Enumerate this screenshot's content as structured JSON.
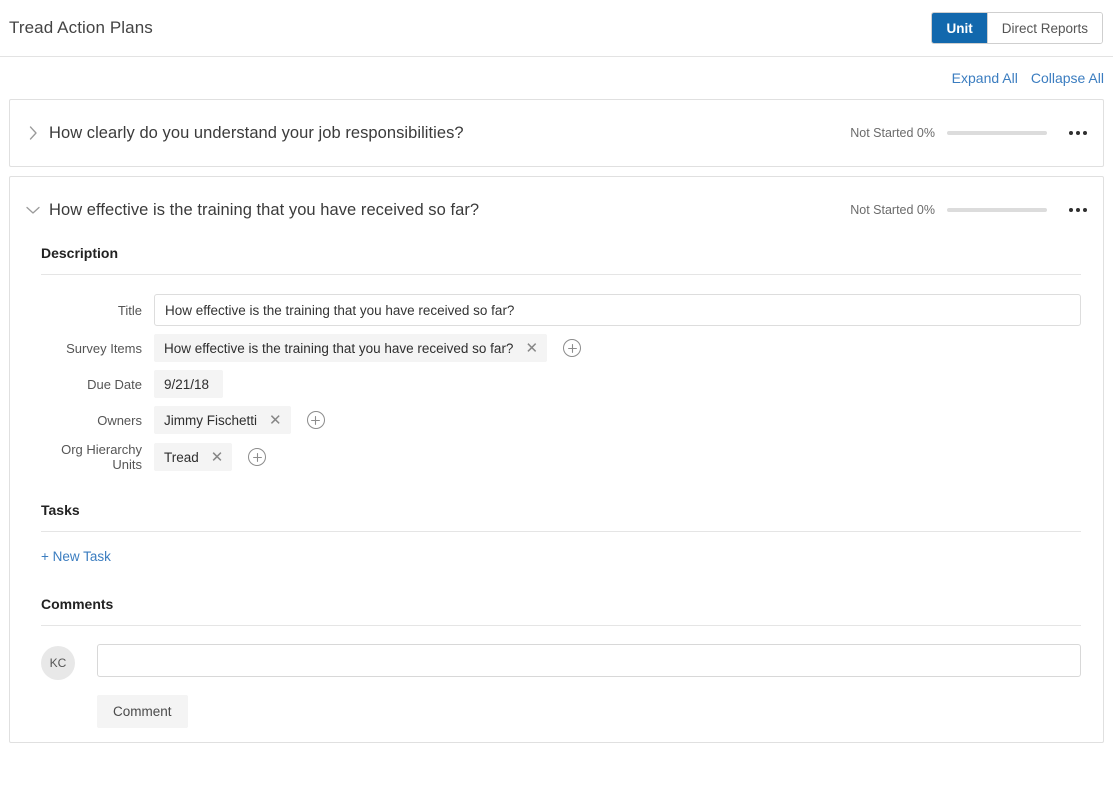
{
  "header": {
    "title": "Tread Action Plans",
    "view_toggle": {
      "options": [
        "Unit",
        "Direct Reports"
      ],
      "selected": "Unit",
      "unit_label": "Unit",
      "direct_reports_label": "Direct Reports",
      "active_color": "#1268ad"
    }
  },
  "toolbar": {
    "expand_all_label": "Expand All",
    "collapse_all_label": "Collapse All",
    "link_color": "#3b7dc0"
  },
  "action_plans": [
    {
      "title": "How clearly do you understand your job responsibilities?",
      "expanded": false,
      "chevron": "chevron-right-icon",
      "status_text": "Not Started 0%",
      "status": "Not Started",
      "progress_percent": 0,
      "menu_icon": "kebab-menu-icon"
    },
    {
      "title": "How effective is the training that you have received so far?",
      "expanded": true,
      "chevron": "chevron-down-icon",
      "status_text": "Not Started 0%",
      "status": "Not Started",
      "progress_percent": 0,
      "menu_icon": "kebab-menu-icon"
    }
  ],
  "detail": {
    "description_section": {
      "heading": "Description",
      "fields": {
        "title": {
          "label": "Title",
          "value": "How effective is the training that you have received so far?",
          "placeholder": ""
        },
        "survey_items": {
          "label": "Survey Items",
          "chips": [
            "How effective is the training that you have received so far?"
          ],
          "remove_icon": "close-icon",
          "add_icon": "plus-circle-icon"
        },
        "due_date": {
          "label": "Due Date",
          "value": "9/21/18"
        },
        "owners": {
          "label": "Owners",
          "chips": [
            "Jimmy Fischetti"
          ],
          "remove_icon": "close-icon",
          "add_icon": "plus-circle-icon"
        },
        "org_hierarchy_units": {
          "label": "Org Hierarchy Units",
          "chips": [
            "Tread"
          ],
          "remove_icon": "close-icon",
          "add_icon": "plus-circle-icon"
        }
      }
    },
    "tasks_section": {
      "heading": "Tasks",
      "new_task_label": "+ New Task"
    },
    "comments_section": {
      "heading": "Comments",
      "avatar_initials": "KC",
      "input_value": "",
      "input_placeholder": "",
      "submit_label": "Comment"
    }
  }
}
